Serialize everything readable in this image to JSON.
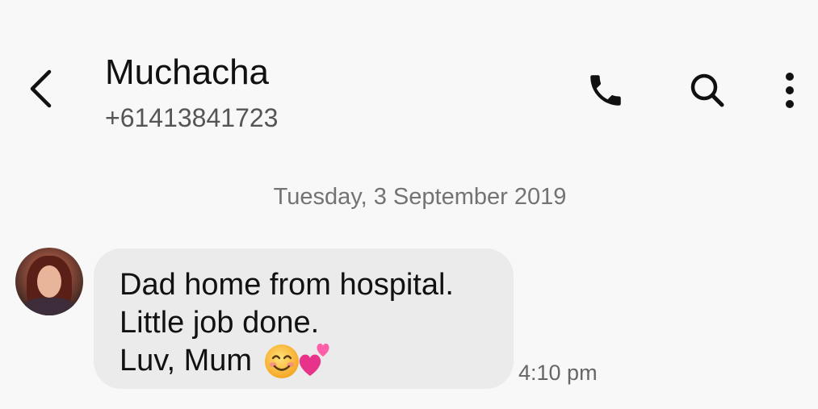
{
  "header": {
    "contact_name": "Muchacha",
    "contact_number": "+61413841723",
    "back_icon": "chevron-left-icon",
    "call_icon": "phone-icon",
    "search_icon": "search-icon",
    "more_icon": "more-vertical-icon"
  },
  "conversation": {
    "date_divider": "Tuesday, 3 September 2019",
    "messages": [
      {
        "lines": [
          "Dad home from hospital.",
          "Little job done.",
          "Luv, Mum"
        ],
        "emoji": "😊💕",
        "time": "4:10 pm"
      }
    ]
  },
  "colors": {
    "background": "#f8f8f8",
    "bubble": "#ebebeb",
    "text": "#111111",
    "secondary_text": "#737373"
  }
}
